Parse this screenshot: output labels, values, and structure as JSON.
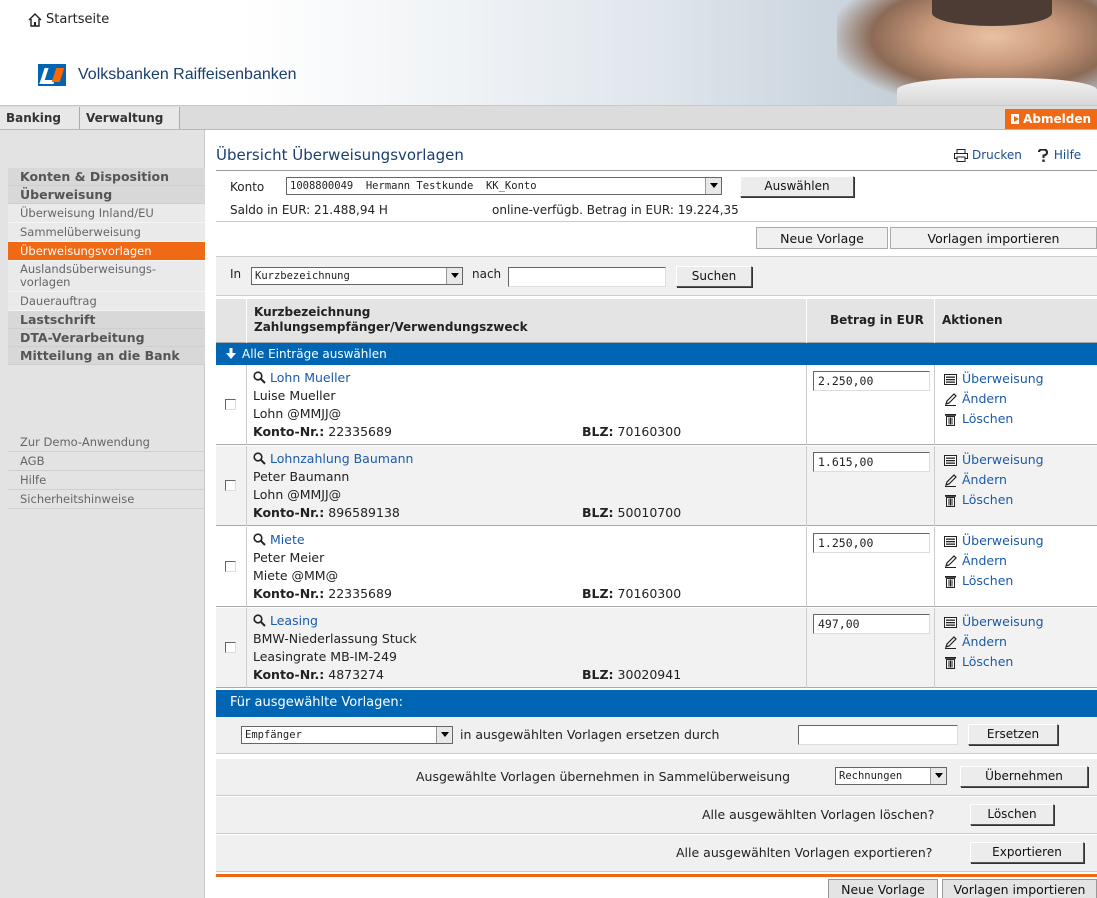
{
  "header": {
    "home_label": "Startseite",
    "brand_name": "Volksbanken Raiffeisenbanken",
    "brand_color": "#0066b3",
    "accent_color": "#f06a15"
  },
  "tabs": {
    "banking": "Banking",
    "verwaltung": "Verwaltung",
    "logout": "Abmelden"
  },
  "sidebar": {
    "main_items": [
      "Konten & Disposition",
      "Überweisung",
      "Lastschrift",
      "DTA-Verarbeitung",
      "Mitteilung an die Bank"
    ],
    "sub_items": [
      "Überweisung Inland/EU",
      "Sammelüberweisung",
      "Überweisungsvorlagen",
      "Auslandsüberweisungs-vorlagen",
      "Dauerauftrag"
    ],
    "active_sub": "Überweisungsvorlagen",
    "meta_items": [
      "Zur Demo-Anwendung",
      "AGB",
      "Hilfe",
      "Sicherheitshinweise"
    ]
  },
  "main": {
    "title": "Übersicht Überweisungsvorlagen",
    "print_label": "Drucken",
    "help_label": "Hilfe",
    "konto_label": "Konto",
    "konto_value": "1008800049  Hermann Testkunde  KK_Konto",
    "select_button": "Auswählen",
    "saldo": "Saldo in EUR: 21.488,94 H",
    "online": "online-verfügb. Betrag in EUR: 19.224,35",
    "new_template": "Neue Vorlage",
    "import_templates": "Vorlagen importieren"
  },
  "search": {
    "in_label": "In",
    "field_value": "Kurzbezeichnung",
    "nach_label": "nach",
    "query": "",
    "button": "Suchen"
  },
  "table": {
    "col1_line1": "Kurzbezeichnung",
    "col1_line2": "Zahlungsempfänger/Verwendungszweck",
    "col2": "Betrag in EUR",
    "col3": "Aktionen",
    "select_all": "Alle Einträge auswählen",
    "konto_label": "Konto-Nr.:",
    "blz_label": "BLZ:",
    "action_transfer": "Überweisung",
    "action_edit": "Ändern",
    "action_delete": "Löschen",
    "rows": [
      {
        "title": "Lohn Mueller",
        "name": "Luise Mueller",
        "purpose": "Lohn @MMJJ@",
        "konto": "22335689",
        "blz": "70160300",
        "amount": "2.250,00"
      },
      {
        "title": "Lohnzahlung Baumann",
        "name": "Peter Baumann",
        "purpose": "Lohn @MMJJ@",
        "konto": "896589138",
        "blz": "50010700",
        "amount": "1.615,00"
      },
      {
        "title": "Miete",
        "name": "Peter Meier",
        "purpose": "Miete @MM@",
        "konto": "22335689",
        "blz": "70160300",
        "amount": "1.250,00"
      },
      {
        "title": "Leasing",
        "name": "BMW-Niederlassung Stuck",
        "purpose": "Leasingrate MB-IM-249",
        "konto": "4873274",
        "blz": "30020941",
        "amount": "497,00"
      }
    ]
  },
  "bulk": {
    "header": "Für ausgewählte Vorlagen:",
    "replace_field": "Empfänger",
    "replace_text": "in ausgewählten Vorlagen ersetzen durch",
    "replace_value": "",
    "replace_button": "Ersetzen",
    "collect_text": "Ausgewählte Vorlagen übernehmen in Sammelüberweisung",
    "collect_select": "Rechnungen",
    "collect_button": "Übernehmen",
    "delete_text": "Alle ausgewählten Vorlagen löschen?",
    "delete_button": "Löschen",
    "export_text": "Alle ausgewählten Vorlagen exportieren?",
    "export_button": "Exportieren"
  },
  "bottom": {
    "new_template": "Neue Vorlage",
    "import_templates": "Vorlagen importieren"
  }
}
